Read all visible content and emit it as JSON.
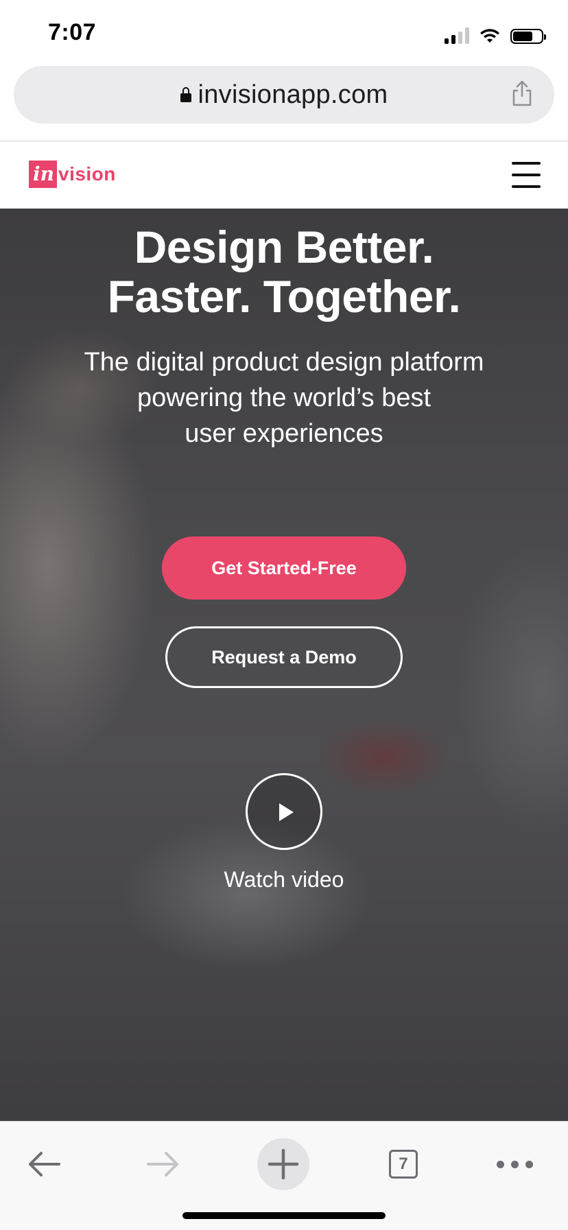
{
  "status_bar": {
    "time": "7:07"
  },
  "browser": {
    "url": "invisionapp.com",
    "tab_count": "7"
  },
  "site": {
    "logo_in": "in",
    "logo_vision": "vision",
    "brand_color": "#e8436b"
  },
  "hero": {
    "title_line1": "Design Better.",
    "title_line2": "Faster. Together.",
    "subtitle_line1": "The digital product design platform",
    "subtitle_line2": "powering the world’s best",
    "subtitle_line3": "user experiences",
    "primary_button": "Get Started-Free",
    "secondary_button": "Request a Demo",
    "watch_label": "Watch video"
  },
  "icons": {
    "lock": "lock-icon",
    "share": "share-icon",
    "menu": "hamburger-menu-icon",
    "play": "play-icon",
    "back": "back-arrow-icon",
    "forward": "forward-arrow-icon",
    "new_tab": "plus-icon",
    "more": "more-dots-icon"
  }
}
